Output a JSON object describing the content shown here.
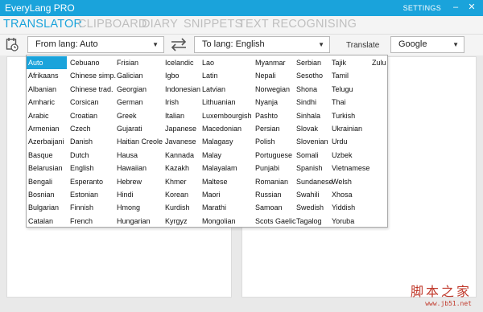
{
  "app": {
    "title": "EveryLang PRO",
    "settings_label": "SETTINGS"
  },
  "tabs": [
    "TRANSLATOR",
    "CLIPBOARD",
    "DIARY",
    "SNIPPETS",
    "TEXT RECOGNISING"
  ],
  "toolbar": {
    "from_lang": "From lang: Auto",
    "to_lang": "To lang: English",
    "translate_label": "Translate",
    "service": "Google"
  },
  "language_columns": [
    [
      "Auto",
      "Afrikaans",
      "Albanian",
      "Amharic",
      "Arabic",
      "Armenian",
      "Azerbaijani",
      "Basque",
      "Belarusian",
      "Bengali",
      "Bosnian",
      "Bulgarian",
      "Catalan"
    ],
    [
      "Cebuano",
      "Chinese simp.",
      "Chinese trad.",
      "Corsican",
      "Croatian",
      "Czech",
      "Danish",
      "Dutch",
      "English",
      "Esperanto",
      "Estonian",
      "Finnish",
      "French"
    ],
    [
      "Frisian",
      "Galician",
      "Georgian",
      "German",
      "Greek",
      "Gujarati",
      "Haitian Creole",
      "Hausa",
      "Hawaiian",
      "Hebrew",
      "Hindi",
      "Hmong",
      "Hungarian"
    ],
    [
      "Icelandic",
      "Igbo",
      "Indonesian",
      "Irish",
      "Italian",
      "Japanese",
      "Javanese",
      "Kannada",
      "Kazakh",
      "Khmer",
      "Korean",
      "Kurdish",
      "Kyrgyz"
    ],
    [
      "Lao",
      "Latin",
      "Latvian",
      "Lithuanian",
      "Luxembourgish",
      "Macedonian",
      "Malagasy",
      "Malay",
      "Malayalam",
      "Maltese",
      "Maori",
      "Marathi",
      "Mongolian"
    ],
    [
      "Myanmar",
      "Nepali",
      "Norwegian",
      "Nyanja",
      "Pashto",
      "Persian",
      "Polish",
      "Portuguese",
      "Punjabi",
      "Romanian",
      "Russian",
      "Samoan",
      "Scots Gaelic"
    ],
    [
      "Serbian",
      "Sesotho",
      "Shona",
      "Sindhi",
      "Sinhala",
      "Slovak",
      "Slovenian",
      "Somali",
      "Spanish",
      "Sundanese",
      "Swahili",
      "Swedish",
      "Tagalog"
    ],
    [
      "Tajik",
      "Tamil",
      "Telugu",
      "Thai",
      "Turkish",
      "Ukrainian",
      "Urdu",
      "Uzbek",
      "Vietnamese",
      "Welsh",
      "Xhosa",
      "Yiddish",
      "Yoruba"
    ],
    [
      "Zulu"
    ]
  ],
  "selected_language": "Auto",
  "watermark": {
    "text": "脚本之家",
    "url": "www.jb51.net"
  },
  "colors": {
    "accent": "#1aa3db",
    "tab_inactive": "#bfbfbf"
  }
}
